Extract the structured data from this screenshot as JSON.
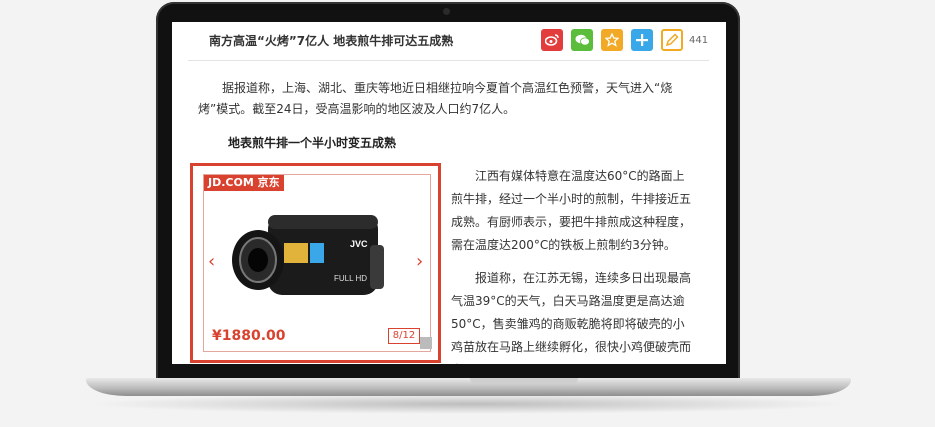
{
  "article": {
    "title": "南方高温“火烤”7亿人 地表煎牛排可达五成熟",
    "share_count": "441",
    "intro": "据报道称，上海、湖北、重庆等地近日相继拉响今夏首个高温红色预警，天气进入“烧烤”模式。截至24日，受高温影响的地区波及人口约7亿人。",
    "subheading": "地表煎牛排一个半小时变五成熟",
    "para2": "江西有媒体特意在温度达60°C的路面上煎牛排，经过一个半小时的煎制，牛排接近五成熟。有厨师表示，要把牛排煎成这种程度，需在温度达200°C的铁板上煎制约3分钟。",
    "para3": "报道称，在江苏无锡，连续多日出现最高气温39°C的天气，白天马路温度更是高达逾50°C，售卖雏鸡的商贩乾脆将即将破壳的小鸡苗放在马路上继续孵化，很快小鸡便破壳而出。"
  },
  "share_icons": [
    {
      "name": "weibo-icon",
      "color": "#e23c3c"
    },
    {
      "name": "wechat-icon",
      "color": "#5bbd3b"
    },
    {
      "name": "qzone-star-icon",
      "color": "#f2a925"
    },
    {
      "name": "plus-icon",
      "color": "#3aa7e8"
    },
    {
      "name": "edit-icon",
      "color": "#f2a925"
    }
  ],
  "ad": {
    "brand": "JD.COM 京东",
    "price": "¥1880.00",
    "page_indicator": "8/12",
    "product_badge": "FULL HD",
    "product_brand": "JVC",
    "prev_symbol": "‹",
    "next_symbol": "›"
  },
  "colors": {
    "accent": "#d9422f"
  }
}
